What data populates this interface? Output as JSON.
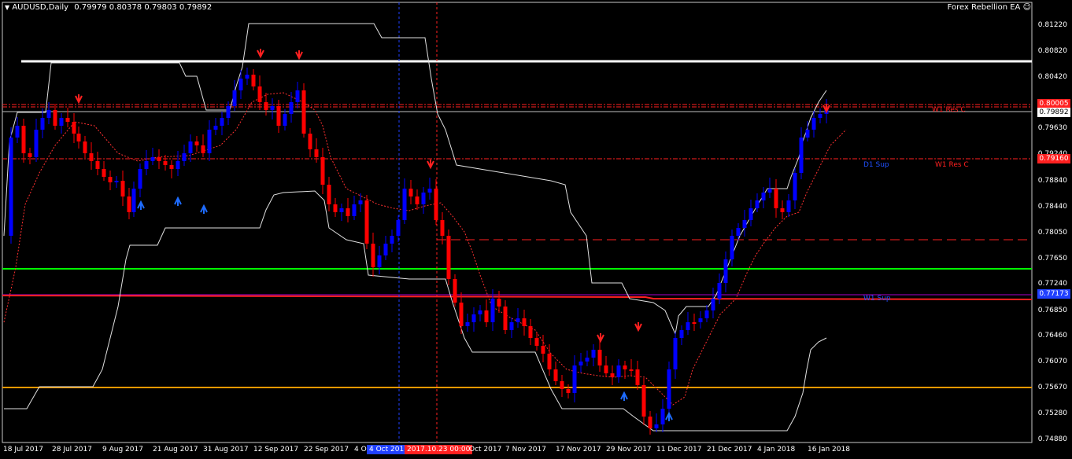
{
  "header": {
    "symbol_label": "AUDUSD,Daily",
    "ohlc": "0.79979 0.80378 0.79803 0.79892",
    "menu_icon": "triangle-down-icon"
  },
  "ea": {
    "label": "Forex Rebellion EA",
    "icon": "smiley-icon"
  },
  "y_axis": {
    "ticks": [
      "0.81220",
      "0.80820",
      "0.80420",
      "0.80005",
      "0.79892",
      "0.79630",
      "0.79240",
      "0.79160",
      "0.78840",
      "0.78440",
      "0.78050",
      "0.77650",
      "0.77240",
      "0.77173",
      "0.76850",
      "0.76460",
      "0.76070",
      "0.75670",
      "0.75280",
      "0.74880"
    ],
    "current_price": "0.79892",
    "res_price": "0.80005",
    "sup_price": "0.79160",
    "low_price": "0.77173"
  },
  "x_axis": {
    "labels": [
      "18 Jul 2017",
      "28 Jul 2017",
      "9 Aug 2017",
      "21 Aug 2017",
      "31 Aug 2017",
      "12 Sep 2017",
      "22 Sep 2017",
      "4 O",
      "Oct 2017",
      "7 Nov 2017",
      "17 Nov 2017",
      "29 Nov 2017",
      "11 Dec 2017",
      "21 Dec 2017",
      "4 Jan 2018",
      "16 Jan 2018"
    ],
    "cursor_blue": "4 Oct 2017",
    "cursor_red": "2017.10.23 00:00"
  },
  "levels": {
    "w1_res": "W1 Res C",
    "w1_res_top": "W1 Res C",
    "d1_sup": "D1 Sup",
    "w1_sup": "W1 Sup"
  },
  "colors": {
    "bull": "#0000ff",
    "bear": "#ff0000",
    "white_line": "#ffffff",
    "green_line": "#00ff00",
    "orange_line": "#ff9900",
    "purple_line": "#aa00cc"
  },
  "chart_data": {
    "type": "candlestick",
    "symbol": "AUDUSD",
    "timeframe": "Daily",
    "last_ohlc": {
      "open": 0.79979,
      "high": 0.80378,
      "low": 0.79803,
      "close": 0.79892
    }
  }
}
